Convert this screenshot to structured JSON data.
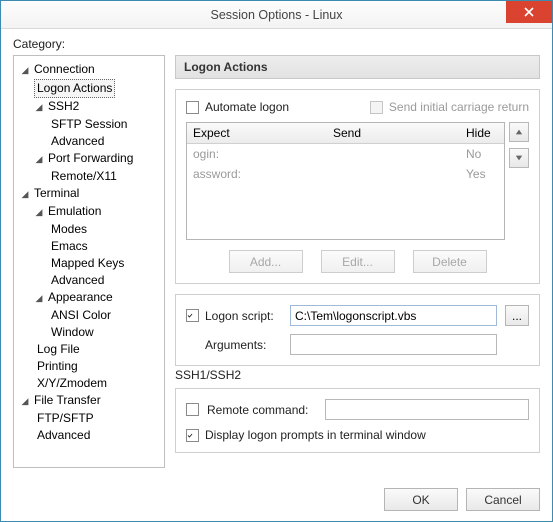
{
  "title": "Session Options - Linux",
  "category_label": "Category:",
  "tree": {
    "connection": "Connection",
    "logon_actions": "Logon Actions",
    "ssh2": "SSH2",
    "sftp_session": "SFTP Session",
    "ssh2_advanced": "Advanced",
    "port_forwarding": "Port Forwarding",
    "remote_x11": "Remote/X11",
    "terminal": "Terminal",
    "emulation": "Emulation",
    "modes": "Modes",
    "emacs": "Emacs",
    "mapped_keys": "Mapped Keys",
    "emu_advanced": "Advanced",
    "appearance": "Appearance",
    "ansi_color": "ANSI Color",
    "window": "Window",
    "log_file": "Log File",
    "printing": "Printing",
    "xyz": "X/Y/Zmodem",
    "file_transfer": "File Transfer",
    "ftp_sftp": "FTP/SFTP",
    "ft_advanced": "Advanced"
  },
  "panel": {
    "title": "Logon Actions",
    "automate_logon": "Automate logon",
    "send_initial": "Send initial carriage return",
    "cols": {
      "expect": "Expect",
      "send": "Send",
      "hide": "Hide"
    },
    "rows": [
      {
        "expect": "ogin:",
        "send": "",
        "hide": "No"
      },
      {
        "expect": "assword:",
        "send": "",
        "hide": "Yes"
      }
    ],
    "buttons": {
      "add": "Add...",
      "edit": "Edit...",
      "del": "Delete"
    },
    "logon_script_label": "Logon script:",
    "logon_script_value": "C:\\Tem\\logonscript.vbs",
    "arguments_label": "Arguments:",
    "arguments_value": "",
    "browse": "...",
    "ssh_group": "SSH1/SSH2",
    "remote_command_label": "Remote command:",
    "remote_command_value": "",
    "display_prompts": "Display logon prompts in terminal window"
  },
  "footer": {
    "ok": "OK",
    "cancel": "Cancel"
  },
  "checks": {
    "automate_logon": false,
    "send_initial": false,
    "logon_script": true,
    "remote_command": false,
    "display_prompts": true
  }
}
